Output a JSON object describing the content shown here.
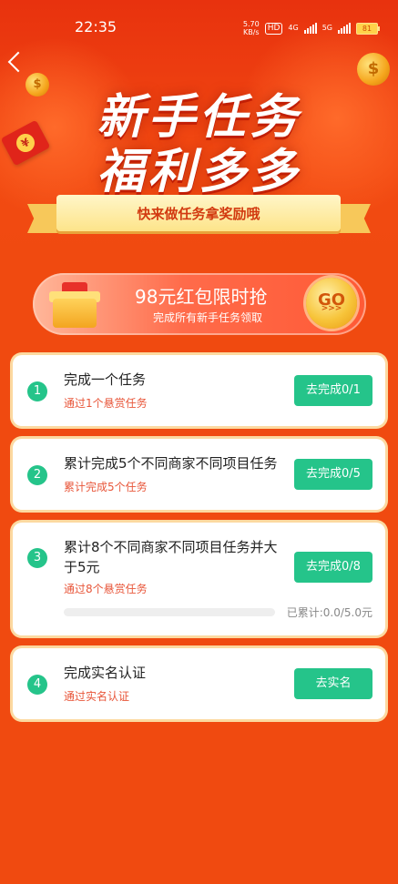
{
  "status_bar": {
    "time": "22:35",
    "speed_value": "5.70",
    "speed_unit": "KB/s",
    "hd": "HD",
    "net1": "4G",
    "net2": "5G",
    "battery": "81"
  },
  "header": {
    "title_line1": "新手任务",
    "title_line2": "福利多多",
    "ribbon": "快来做任务拿奖励哦",
    "envelope_symbol": "¥",
    "coin_symbol": "$"
  },
  "promo": {
    "title": "98元红包限时抢",
    "subtitle": "完成所有新手任务领取",
    "go_label": "GO",
    "go_arrows": ">>>"
  },
  "tasks": [
    {
      "num": "1",
      "title": "完成一个任务",
      "subtitle": "通过1个悬赏任务",
      "button": "去完成0/1"
    },
    {
      "num": "2",
      "title": "累计完成5个不同商家不同项目任务",
      "subtitle": "累计完成5个任务",
      "button": "去完成0/5"
    },
    {
      "num": "3",
      "title_line1": "累计8个不同商家不同项目任务并大",
      "title_line2": "于5元",
      "subtitle": "通过8个悬赏任务",
      "button": "去完成0/8",
      "progress_text": "已累计:0.0/5.0元",
      "progress": 0.0
    },
    {
      "num": "4",
      "title": "完成实名认证",
      "subtitle": "通过实名认证",
      "button": "去实名"
    }
  ],
  "colors": {
    "background": "#f04a10",
    "accent_green": "#25c48a",
    "subtitle_red": "#e8563a"
  },
  "icons": [
    "back-icon",
    "gift-icon",
    "coin-icon",
    "red-envelope-icon",
    "signal-icon",
    "battery-icon"
  ]
}
